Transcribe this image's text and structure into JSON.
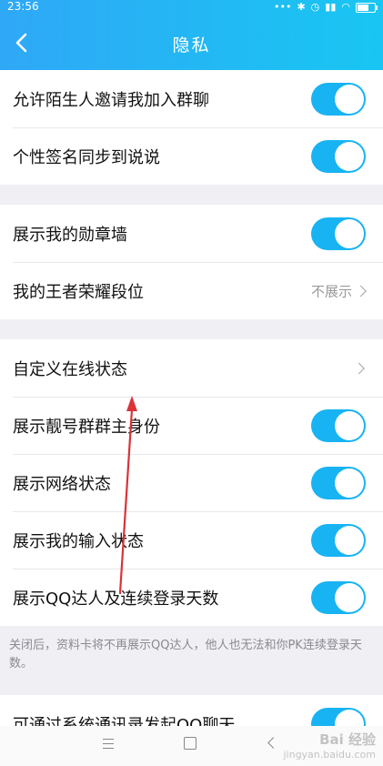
{
  "status_bar": {
    "time": "23:56"
  },
  "header": {
    "title": "隐私",
    "accent": "#18b3f3"
  },
  "groups": [
    {
      "rows": [
        {
          "label": "允许陌生人邀请我加入群聊",
          "type": "toggle",
          "on": true
        },
        {
          "label": "个性签名同步到说说",
          "type": "toggle",
          "on": true
        }
      ]
    },
    {
      "rows": [
        {
          "label": "展示我的勋章墙",
          "type": "toggle",
          "on": true
        },
        {
          "label": "我的王者荣耀段位",
          "type": "link",
          "value": "不展示"
        }
      ]
    },
    {
      "rows": [
        {
          "label": "自定义在线状态",
          "type": "link",
          "value": ""
        },
        {
          "label": "展示靓号群群主身份",
          "type": "toggle",
          "on": true
        },
        {
          "label": "展示网络状态",
          "type": "toggle",
          "on": true
        },
        {
          "label": "展示我的输入状态",
          "type": "toggle",
          "on": true
        },
        {
          "label": "展示QQ达人及连续登录天数",
          "type": "toggle",
          "on": true
        }
      ]
    }
  ],
  "footnote": "关闭后，资料卡将不再展示QQ达人，他人也无法和你PK连续登录天数。",
  "partial_row": {
    "label": "可通过系统通讯录发起QQ聊天",
    "on": true
  },
  "watermark": {
    "line1": "Bai 经验",
    "line2": "jingyan.baidu.com"
  }
}
